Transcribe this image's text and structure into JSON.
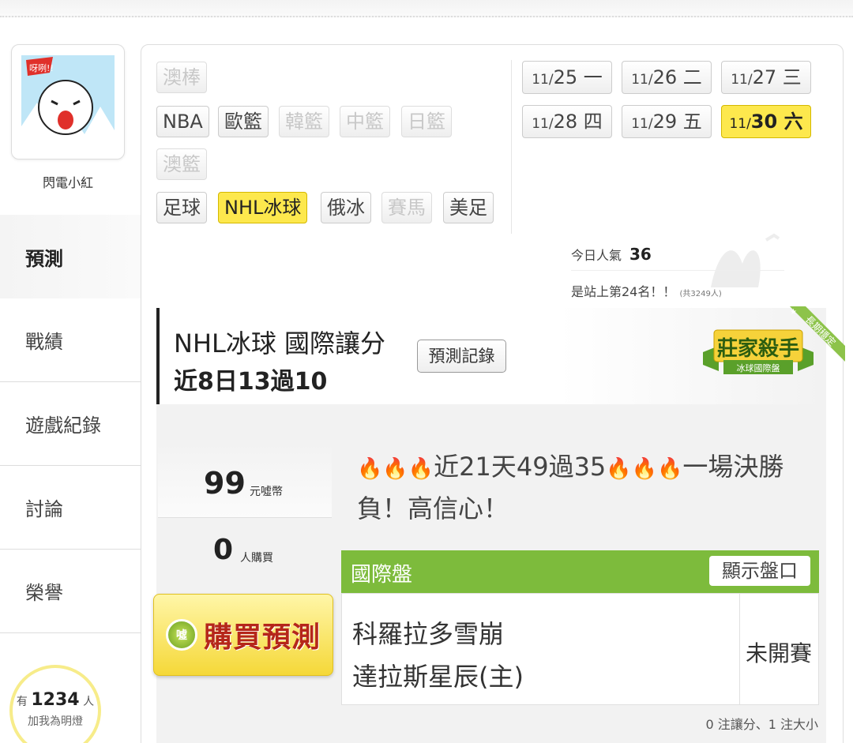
{
  "user": {
    "name": "閃電小紅",
    "avatar_text": "呀咧!!"
  },
  "sidebar": {
    "items": [
      {
        "label": "預測",
        "active": true
      },
      {
        "label": "戰績"
      },
      {
        "label": "遊戲紀錄"
      },
      {
        "label": "討論"
      },
      {
        "label": "榮譽"
      }
    ]
  },
  "fans": {
    "prefix": "有",
    "count": "1234",
    "suffix": "人",
    "cta": "加我為明燈"
  },
  "categories": {
    "aus_baseball": "澳棒",
    "nba": "NBA",
    "euro_bb": "歐籃",
    "korea_bb": "韓籃",
    "china_bb": "中籃",
    "japan_bb": "日籃",
    "aus_bb": "澳籃",
    "football": "足球",
    "nhl": "NHL冰球",
    "khl": "俄冰",
    "horse": "賽馬",
    "nfl": "美足"
  },
  "dates": [
    {
      "md": "11/",
      "day": "25",
      "wk": "一"
    },
    {
      "md": "11/",
      "day": "26",
      "wk": "二"
    },
    {
      "md": "11/",
      "day": "27",
      "wk": "三"
    },
    {
      "md": "11/",
      "day": "28",
      "wk": "四"
    },
    {
      "md": "11/",
      "day": "29",
      "wk": "五"
    },
    {
      "md": "11/",
      "day": "30",
      "wk": "六",
      "selected": true
    }
  ],
  "popularity": {
    "label": "今日人氣",
    "value": "36",
    "rank_text": "是站上第24名！！",
    "total": "(共3249人)"
  },
  "header": {
    "title": "NHL冰球 國際讓分",
    "record": "近8日13過10",
    "record_button": "預測記錄"
  },
  "badge": {
    "title": "莊家殺手",
    "subtitle": "冰球國際盤",
    "ribbon": "長期穩定",
    "star": "★"
  },
  "pricing": {
    "price": "99",
    "price_unit": "元噓幣",
    "buyers": "0",
    "buyers_unit": "人購買"
  },
  "buy": {
    "label": "購買預測",
    "coin_text": "噓"
  },
  "description": {
    "fire": "🔥🔥🔥",
    "part1": "近21天49過35",
    "part2": "一場決勝負！高信心！"
  },
  "panel": {
    "title": "國際盤",
    "show_odds": "顯示盤口"
  },
  "match": {
    "away": "科羅拉多雪崩",
    "home": "達拉斯星辰(主)",
    "status": "未開賽"
  },
  "bet_count": "0 注讓分、1 注大小"
}
